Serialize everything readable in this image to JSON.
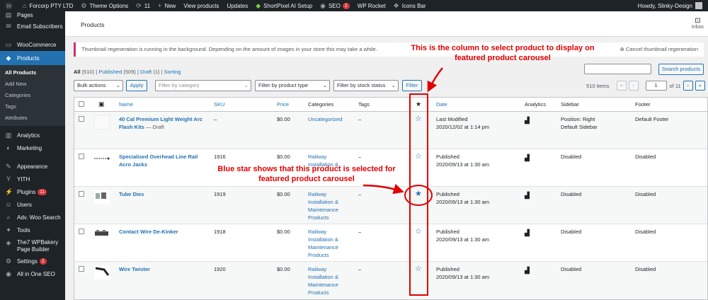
{
  "adminbar": {
    "items": [
      {
        "icon": "wordpress-icon",
        "label": ""
      },
      {
        "icon": "home-icon",
        "label": "Forcorp PTY LTD"
      },
      {
        "icon": "gear-icon",
        "label": "Theme Options"
      },
      {
        "icon": "refresh-icon",
        "label": "11"
      },
      {
        "icon": "plus-icon",
        "label": "New"
      },
      {
        "icon": "",
        "label": "View products"
      },
      {
        "icon": "",
        "label": "Updates"
      },
      {
        "icon": "shortpixel-icon",
        "label": "ShortPixel AI Setup"
      },
      {
        "icon": "seo-icon",
        "label": "SEO",
        "badge": "1"
      },
      {
        "icon": "",
        "label": "WP Rocket"
      },
      {
        "icon": "icons-bar-icon",
        "label": "Icons Bar"
      }
    ],
    "greeting": "Howdy, Slinky-Design"
  },
  "sidebar": {
    "items": [
      {
        "icon": "pages-icon",
        "label": "Pages"
      },
      {
        "icon": "email-icon",
        "label": "Email Subscribers"
      },
      {
        "icon": "woocommerce-icon",
        "label": "WooCommerce"
      },
      {
        "icon": "products-icon",
        "label": "Products"
      },
      {
        "icon": "analytics-icon",
        "label": "Analytics"
      },
      {
        "icon": "marketing-icon",
        "label": "Marketing"
      },
      {
        "icon": "appearance-icon",
        "label": "Appearance"
      },
      {
        "icon": "yith-icon",
        "label": "YITH"
      },
      {
        "icon": "plugins-icon",
        "label": "Plugins",
        "badge": "11"
      },
      {
        "icon": "users-icon",
        "label": "Users"
      },
      {
        "icon": "search-icon",
        "label": "Adv. Woo Search"
      },
      {
        "icon": "tools-icon",
        "label": "Tools"
      },
      {
        "icon": "wpbakery-icon",
        "label": "The7 WPBakery Page Builder"
      },
      {
        "icon": "settings-icon",
        "label": "Settings",
        "badge": "2"
      },
      {
        "icon": "seo-icon",
        "label": "All in One SEO"
      }
    ],
    "submenu": [
      "All Products",
      "Add New",
      "Categories",
      "Tags",
      "Attributes"
    ]
  },
  "header": {
    "title": "Products",
    "inbox_label": "Inbox"
  },
  "notice": {
    "text": "Thumbnail regeneration is running in the background. Depending on the amount of images in your store this may take a while.",
    "cancel": "Cancel thumbnail regeneration"
  },
  "views": {
    "all": "All",
    "all_count": "(510)",
    "published": "Published",
    "published_count": "(509)",
    "draft": "Draft",
    "draft_count": "(1)",
    "sorting": "Sorting"
  },
  "search": {
    "button": "Search products",
    "value": ""
  },
  "filters": {
    "bulk": "Bulk actions",
    "apply": "Apply",
    "category": "Filter by category",
    "type": "Filter by product type",
    "stock": "Filter by stock status",
    "filter": "Filter"
  },
  "pagination": {
    "items": "510 items",
    "first": "«",
    "prev": "‹",
    "current": "1",
    "of": "of 11",
    "next": "›",
    "last": "»"
  },
  "table": {
    "columns": {
      "name": "Name",
      "sku": "SKU",
      "price": "Price",
      "categories": "Categories",
      "tags": "Tags",
      "featured": "★",
      "date": "Date",
      "analytics": "Analytics",
      "sidebar": "Sidebar",
      "footer": "Footer"
    },
    "rows": [
      {
        "name": "40 Cal Premium Light Weight Arc Flash Kits",
        "state": "— Draft",
        "sku": "–",
        "price": "$0.00",
        "category": "Uncategorized",
        "tags": "–",
        "featured": false,
        "date_status": "Last Modified",
        "date": "2020/12/02 at 1:14 pm",
        "sidebar": "Position: Right\nDefault Sidebar",
        "footer": "Default Footer"
      },
      {
        "name": "Specialised Overhead Line Rail Acro Jacks",
        "state": "",
        "sku": "1916",
        "price": "$0.00",
        "category": "Railway Installation & Maintenance Products",
        "tags": "–",
        "featured": false,
        "date_status": "Published",
        "date": "2020/09/13 at 1:30 am",
        "sidebar": "Disabled",
        "footer": "Disabled"
      },
      {
        "name": "Tube Dies",
        "state": "",
        "sku": "1919",
        "price": "$0.00",
        "category": "Railway Installation & Maintenance Products",
        "tags": "–",
        "featured": true,
        "date_status": "Published",
        "date": "2020/09/13 at 1:30 am",
        "sidebar": "Disabled",
        "footer": "Disabled"
      },
      {
        "name": "Contact Wire De-Kinker",
        "state": "",
        "sku": "1918",
        "price": "$0.00",
        "category": "Railway Installation & Maintenance Products",
        "tags": "–",
        "featured": false,
        "date_status": "Published",
        "date": "2020/09/13 at 1:30 am",
        "sidebar": "Disabled",
        "footer": "Disabled"
      },
      {
        "name": "Wire Twister",
        "state": "",
        "sku": "1920",
        "price": "$0.00",
        "category": "Railway Installation & Maintenance Products",
        "tags": "–",
        "featured": false,
        "date_status": "Published",
        "date": "2020/09/13 at 1:30 am",
        "sidebar": "Disabled",
        "footer": "Disabled"
      }
    ]
  },
  "annotations": {
    "top_line1": "This is the column to select product to display on",
    "top_line2": "featured product carousel",
    "mid_line1": "Blue star shows that this product is selected for",
    "mid_line2": "featured product carousel",
    "color": "#e00000"
  }
}
